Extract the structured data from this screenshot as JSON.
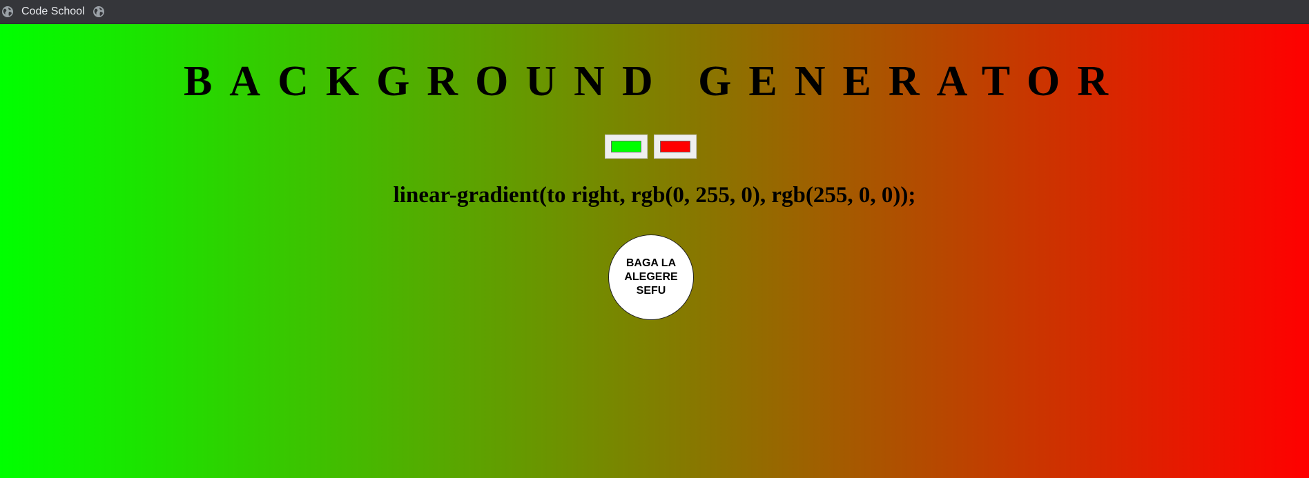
{
  "bookmarks": [
    {
      "label": "Code School",
      "icon": "globe-icon"
    },
    {
      "label": "",
      "icon": "globe-icon"
    }
  ],
  "page": {
    "title": "BACKGROUND GENERATOR",
    "color1": "#00ff00",
    "color2": "#ff0000",
    "css_output": "linear-gradient(to right, rgb(0, 255, 0), rgb(255, 0, 0));",
    "random_button_label": "BAGA LA ALEGERE SEFU"
  },
  "colors": {
    "bookmarks_bar_bg": "#35363a",
    "bookmark_text": "#e8eaed",
    "gradient_start": "#00ff00",
    "gradient_end": "#ff0000"
  }
}
